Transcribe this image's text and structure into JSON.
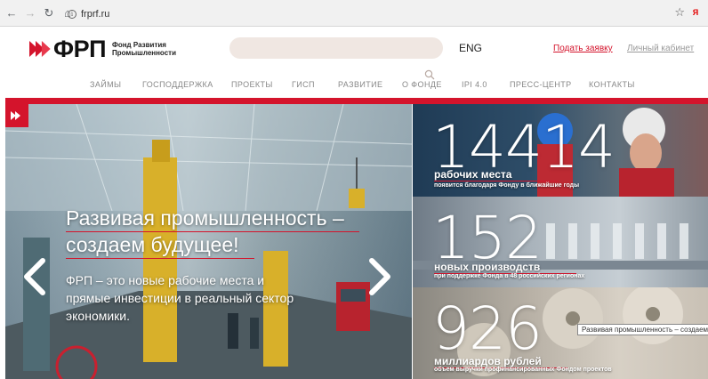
{
  "browser": {
    "url": "frprf.ru"
  },
  "header": {
    "logo_text": "ФРП",
    "logo_sub_line1": "Фонд Развития",
    "logo_sub_line2": "Промышленности",
    "search_placeholder": "",
    "lang": "ENG",
    "apply_link": "Подать заявку",
    "cabinet_link": "Личный кабинет"
  },
  "menu": {
    "items": [
      "Займы",
      "Господдержка",
      "Проекты",
      "ГИСП",
      "Развитие",
      "О фонде",
      "IPI 4.0",
      "Пресс-центр",
      "Контакты"
    ]
  },
  "hero": {
    "title_line1": "Развивая промышленность –",
    "title_line2": "создаем будущее!",
    "text": "ФРП – это новые рабочие места и прямые инвестиции в реальный сектор экономики."
  },
  "stats": [
    {
      "number": "14414",
      "label": "рабочих места",
      "sub": "появится благодаря Фонду в ближайшие годы"
    },
    {
      "number": "152",
      "label": "новых производств",
      "sub": "при поддержке Фонда в 48 российских регионах"
    },
    {
      "number": "926",
      "label": "миллиардов рублей",
      "sub": "объем выручки профинансированных Фондом проектов"
    }
  ],
  "tooltip": "Развивая промышленность – создаем буду",
  "colors": {
    "brand_red": "#d4142c",
    "search_bg": "#f0e7e2"
  }
}
